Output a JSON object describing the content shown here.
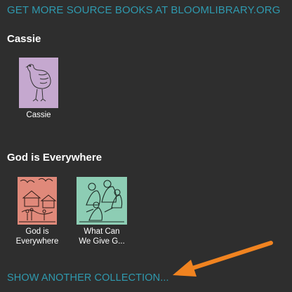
{
  "links": {
    "get_more": "GET MORE SOURCE BOOKS AT BLOOMLIBRARY.ORG",
    "show_another": "SHOW ANOTHER COLLECTION..."
  },
  "collections": [
    {
      "title": "Cassie",
      "books": [
        {
          "label": "Cassie",
          "thumb_color": "#c5a8cf",
          "icon": "cassowary-drawing"
        }
      ]
    },
    {
      "title": "God is Everywhere",
      "books": [
        {
          "label_line1": "God is",
          "label_line2": "Everywhere",
          "thumb_color": "#e0897a",
          "icon": "village-drawing"
        },
        {
          "label_line1": "What Can",
          "label_line2": "We Give G...",
          "thumb_color": "#8dcdb4",
          "icon": "people-drawing"
        }
      ]
    }
  ],
  "annotation": {
    "arrow_color": "#f08320"
  }
}
